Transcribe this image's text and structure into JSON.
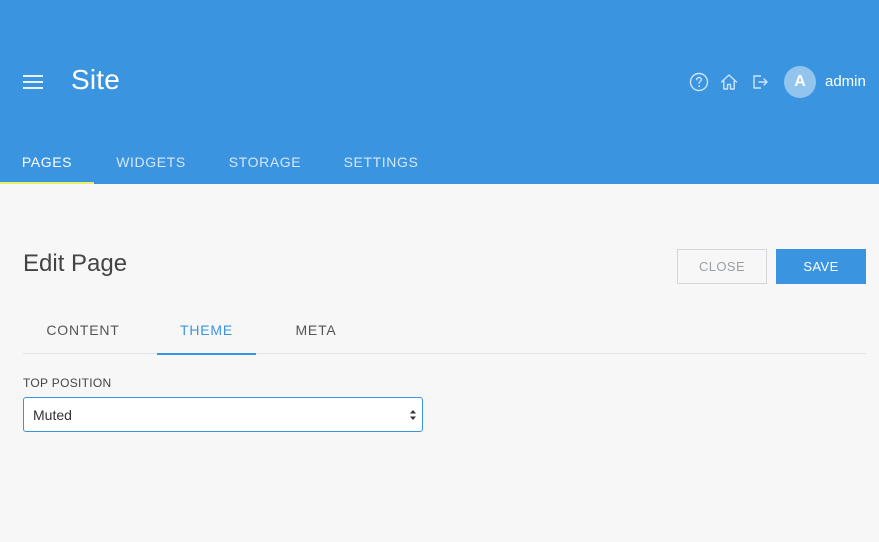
{
  "header": {
    "title": "Site",
    "user": {
      "initial": "A",
      "name": "admin"
    },
    "icons": [
      "help-icon",
      "home-icon",
      "logout-icon"
    ],
    "nav_tabs": [
      {
        "label": "PAGES",
        "active": true
      },
      {
        "label": "WIDGETS",
        "active": false
      },
      {
        "label": "STORAGE",
        "active": false
      },
      {
        "label": "SETTINGS",
        "active": false
      }
    ]
  },
  "main": {
    "title": "Edit Page",
    "buttons": {
      "close": "CLOSE",
      "save": "SAVE"
    },
    "tabs": [
      {
        "label": "CONTENT",
        "active": false
      },
      {
        "label": "THEME",
        "active": true
      },
      {
        "label": "META",
        "active": false
      }
    ],
    "field": {
      "label": "TOP POSITION",
      "value": "Muted"
    }
  },
  "colors": {
    "primary": "#3a94e0",
    "nav_indicator": "#e6f06a",
    "background": "#f7f7f8"
  }
}
